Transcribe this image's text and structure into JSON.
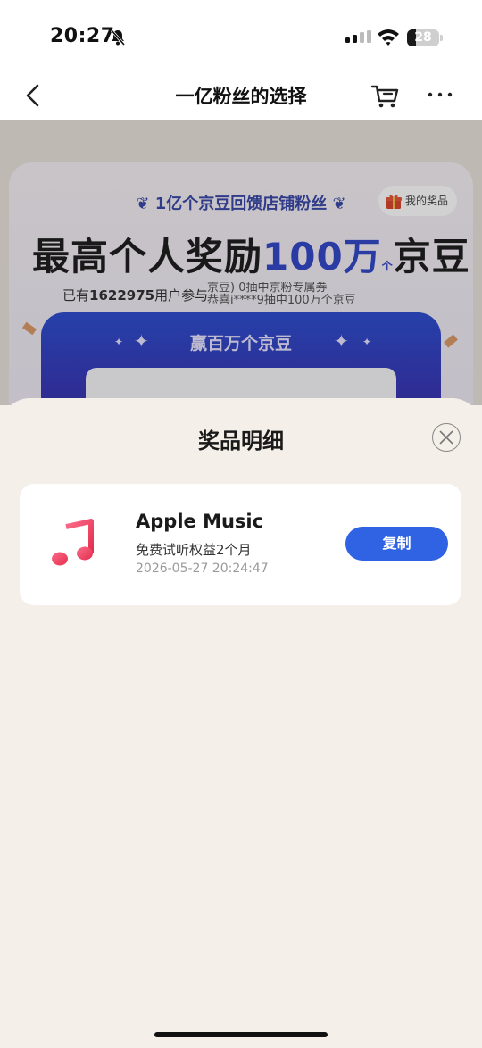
{
  "status_bar": {
    "time": "20:27",
    "battery": "28",
    "battery_level": 0.28,
    "icons": [
      "bell-muted-icon",
      "signal-icon",
      "wifi-icon",
      "battery-icon"
    ]
  },
  "nav": {
    "title": "一亿粉丝的选择",
    "icons": [
      "back-icon",
      "cart-icon",
      "more-icon"
    ]
  },
  "promo": {
    "subtitle": "1亿个京豆回馈店铺粉丝",
    "my_prize_label": "我的奖品",
    "headline_prefix": "最高个人奖励",
    "headline_amount": "100万",
    "headline_unit_small": "个",
    "headline_suffix": "京豆",
    "participants_prefix": "已有",
    "participants_count": "1622975",
    "participants_suffix": "用户参与",
    "ticker_line1": "京豆)     0抽中京粉专属券",
    "ticker_line2": "恭喜i****9抽中100万个京豆",
    "win_button_label": "赢百万个京豆"
  },
  "sheet": {
    "title": "奖品明细",
    "close_icon": "close-icon",
    "prize": {
      "icon": "apple-music-icon",
      "name": "Apple Music",
      "description": "免费试听权益2个月",
      "date": "2026-05-27 20:24:47",
      "copy_label": "复制"
    }
  },
  "colors": {
    "accent_blue": "#2f63e3",
    "sheet_bg": "#f4efe8"
  }
}
